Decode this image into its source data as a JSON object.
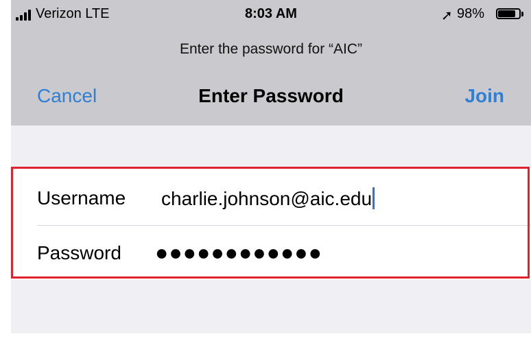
{
  "status_bar": {
    "carrier": "Verizon  LTE",
    "time": "8:03 AM",
    "location_icon": "location-arrow-icon",
    "battery_percent": "98%",
    "battery_level": 0.9
  },
  "prompt": "Enter the password for “AIC”",
  "nav": {
    "cancel_label": "Cancel",
    "title": "Enter Password",
    "join_label": "Join"
  },
  "form": {
    "username_label": "Username",
    "username_value": "charlie.johnson@aic.edu",
    "password_label": "Password",
    "password_value": "●●●●●●●●●●●●"
  },
  "colors": {
    "accent": "#2f7fd6",
    "highlight_border": "#e0212e",
    "header_bg": "#c9c9ce",
    "page_bg": "#efeff4"
  }
}
